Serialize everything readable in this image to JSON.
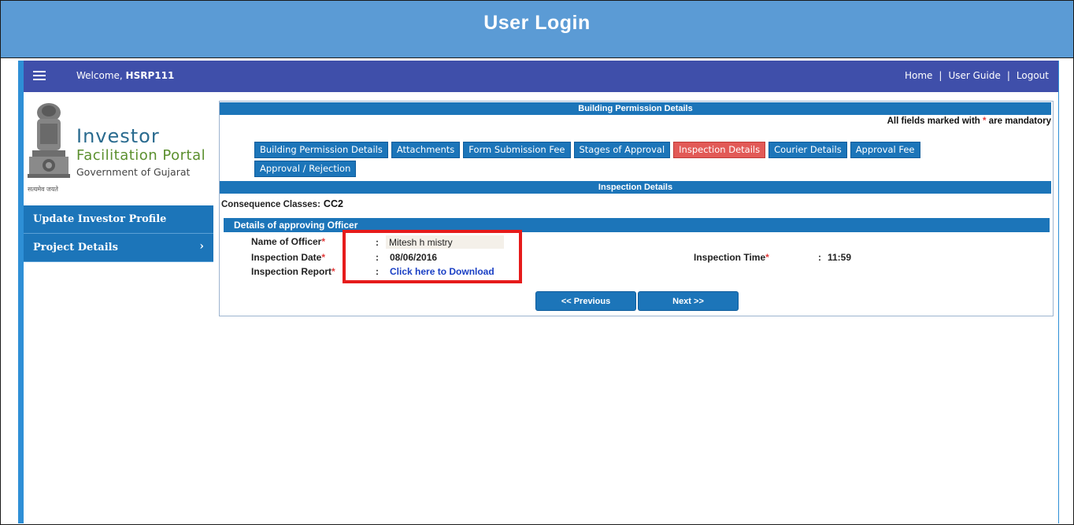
{
  "header": {
    "title": "User Login"
  },
  "topbar": {
    "welcome_prefix": "Welcome,",
    "username": "HSRP111",
    "links": [
      "Home",
      "User Guide",
      "Logout"
    ],
    "separator": "|"
  },
  "logo": {
    "line1": "Investor",
    "line2": "Facilitation Portal",
    "line3": "Government of Gujarat",
    "motto": "सत्यमेव जयते"
  },
  "sidebar": {
    "items": [
      {
        "label": "Update Investor Profile"
      },
      {
        "label": "Project Details",
        "chevron": "›"
      }
    ]
  },
  "main": {
    "section_title": "Building Permission Details",
    "mandatory_prefix": "All fields marked with",
    "mandatory_star": "*",
    "mandatory_suffix": "are mandatory",
    "tabs": [
      {
        "label": "Building Permission Details",
        "active": false
      },
      {
        "label": "Attachments",
        "active": false
      },
      {
        "label": "Form Submission Fee",
        "active": false
      },
      {
        "label": "Stages of Approval",
        "active": false
      },
      {
        "label": "Inspection Details",
        "active": true
      },
      {
        "label": "Courier Details",
        "active": false
      },
      {
        "label": "Approval Fee",
        "active": false
      },
      {
        "label": "Approval / Rejection",
        "active": false
      }
    ],
    "inspection_title": "Inspection Details",
    "consequence_label": "Consequence Classes:",
    "consequence_value": "CC2",
    "officer_section_title": "Details of approving Officer",
    "fields": {
      "officer_label": "Name of Officer",
      "officer_value": "Mitesh h mistry",
      "date_label": "Inspection Date",
      "date_value": "08/06/2016",
      "time_label": "Inspection Time",
      "time_value": "11:59",
      "report_label": "Inspection Report",
      "report_link": "Click here to Download",
      "colon": ":",
      "star": "*"
    },
    "buttons": {
      "previous": "<< Previous",
      "next": "Next >>"
    }
  },
  "colors": {
    "title_bar": "#5b9bd5",
    "topbar": "#3f4faa",
    "primary": "#1c75b9",
    "active_tab": "#e25a57",
    "highlight": "#e61b1b"
  }
}
